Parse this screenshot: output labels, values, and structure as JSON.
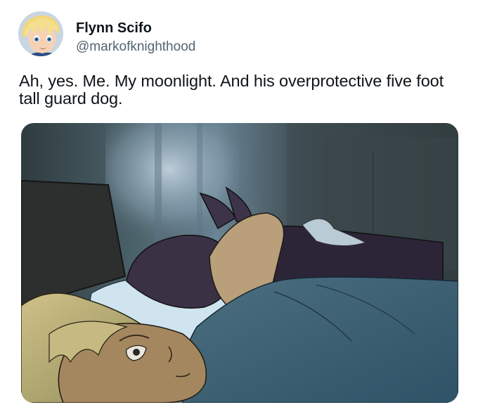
{
  "tweet": {
    "author": {
      "display_name": "Flynn Scifo",
      "handle": "@markofknighthood",
      "avatar_icon": "avatar-blonde-anime-boy"
    },
    "text": "Ah, yes. Me. My moonlight. And his overprotective five foot tall guard dog.",
    "media": {
      "type": "illustration",
      "icon": "comic-panel-image"
    }
  }
}
